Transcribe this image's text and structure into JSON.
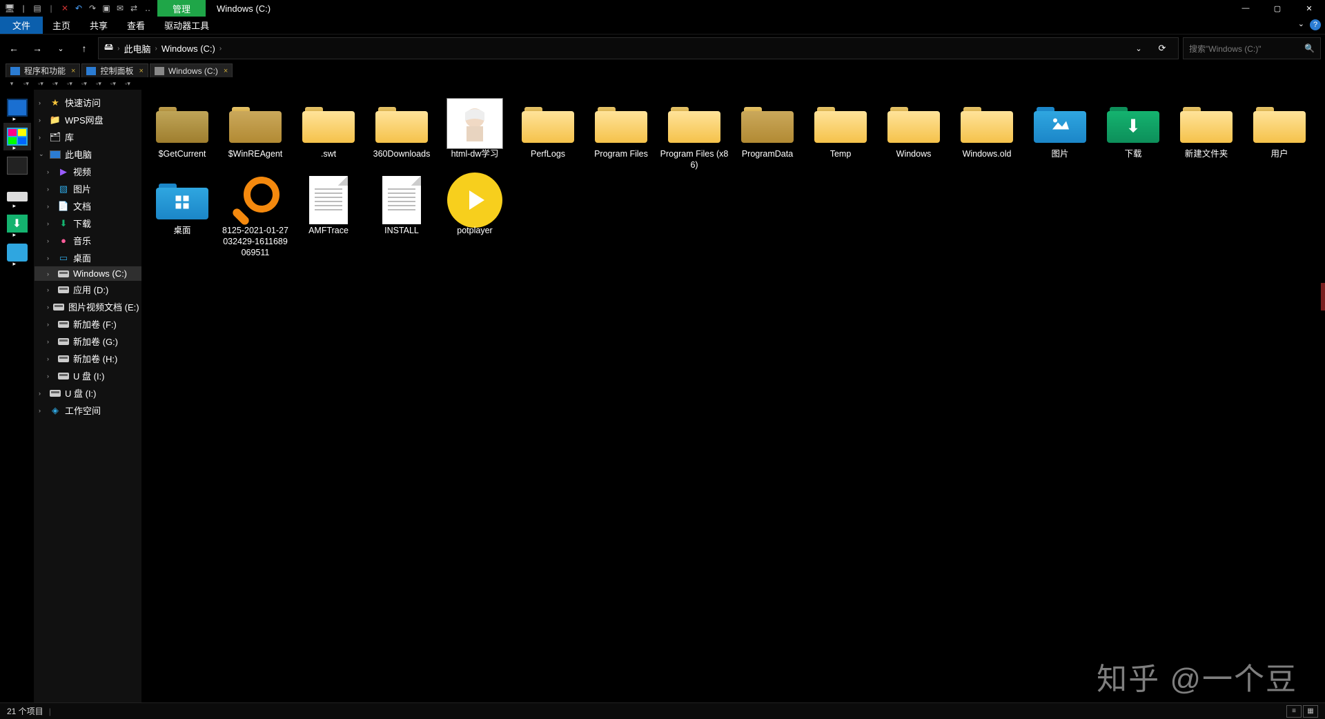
{
  "titlebar": {
    "mgmt": "管理",
    "title": "Windows (C:)"
  },
  "ribbon": {
    "file": "文件",
    "tabs": [
      "主页",
      "共享",
      "查看",
      "驱动器工具"
    ]
  },
  "nav": {
    "breadcrumb": [
      "此电脑",
      "Windows (C:)"
    ],
    "search_placeholder": "搜索\"Windows (C:)\""
  },
  "doctabs": [
    {
      "label": "程序和功能"
    },
    {
      "label": "控制面板"
    },
    {
      "label": "Windows (C:)",
      "active": true
    }
  ],
  "tree": {
    "quick": "快速访问",
    "wps": "WPS网盘",
    "lib": "库",
    "thispc": "此电脑",
    "children": [
      "视频",
      "图片",
      "文档",
      "下载",
      "音乐",
      "桌面"
    ],
    "drives": [
      "Windows (C:)",
      "应用 (D:)",
      "图片视频文档 (E:)",
      "新加卷 (F:)",
      "新加卷 (G:)",
      "新加卷 (H:)",
      "U 盘 (I:)"
    ],
    "usb": "U 盘 (I:)",
    "workspace": "工作空间"
  },
  "items": [
    {
      "name": "$GetCurrent",
      "type": "folder-darker"
    },
    {
      "name": "$WinREAgent",
      "type": "folder-dark"
    },
    {
      "name": ".swt",
      "type": "folder"
    },
    {
      "name": "360Downloads",
      "type": "folder"
    },
    {
      "name": "html-dw学习",
      "type": "image"
    },
    {
      "name": "PerfLogs",
      "type": "folder"
    },
    {
      "name": "Program Files",
      "type": "folder"
    },
    {
      "name": "Program Files (x86)",
      "type": "folder"
    },
    {
      "name": "ProgramData",
      "type": "folder-dark"
    },
    {
      "name": "Temp",
      "type": "folder"
    },
    {
      "name": "Windows",
      "type": "folder"
    },
    {
      "name": "Windows.old",
      "type": "folder"
    },
    {
      "name": "图片",
      "type": "bluefolder-pic"
    },
    {
      "name": "下载",
      "type": "greenfolder-dl"
    },
    {
      "name": "新建文件夹",
      "type": "folder"
    },
    {
      "name": "用户",
      "type": "folder"
    },
    {
      "name": "桌面",
      "type": "bluefolder-desk"
    },
    {
      "name": "8125-2021-01-27032429-1611689069511",
      "type": "magnifier"
    },
    {
      "name": "AMFTrace",
      "type": "doc"
    },
    {
      "name": "INSTALL",
      "type": "doc"
    },
    {
      "name": "potplayer",
      "type": "play"
    }
  ],
  "status": {
    "count": "21 个项目"
  },
  "watermark": "知乎 @一个豆"
}
